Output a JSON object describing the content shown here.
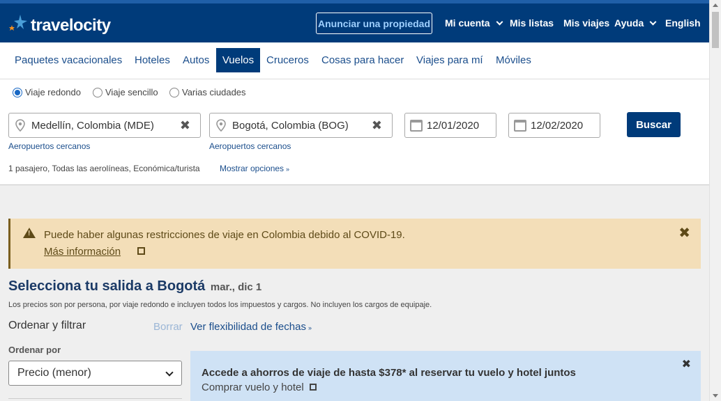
{
  "header": {
    "logo_text": "travelocity",
    "advertise_label": "Anunciar una propiedad",
    "nav": [
      "Mi cuenta",
      "Mis listas",
      "Mis viajes",
      "Ayuda",
      "English"
    ]
  },
  "tabs": [
    "Paquetes vacacionales",
    "Hoteles",
    "Autos",
    "Vuelos",
    "Cruceros",
    "Cosas para hacer",
    "Viajes para mí",
    "Móviles"
  ],
  "active_tab": "Vuelos",
  "search": {
    "trip_types": [
      "Viaje redondo",
      "Viaje sencillo",
      "Varias ciudades"
    ],
    "selected_trip_type": "Viaje redondo",
    "origin": "Medellín, Colombia (MDE)",
    "destination": "Bogotá, Colombia (BOG)",
    "depart_date": "12/01/2020",
    "return_date": "12/02/2020",
    "nearby_label": "Aeropuertos cercanos",
    "search_button": "Buscar",
    "passengers_summary": "1 pasajero, Todas las aerolíneas, Económica/turista",
    "show_options": "Mostrar opciones"
  },
  "alert": {
    "text": "Puede haber algunas restricciones de viaje en Colombia debido al COVID-19.",
    "link": "Más información"
  },
  "results": {
    "heading": "Selecciona tu salida a Bogotá",
    "heading_date": "mar., dic 1",
    "price_note": "Los precios son por persona, por viaje redondo e incluyen todos los impuestos y cargos. No incluyen los cargos de equipaje.",
    "sort_filter_title": "Ordenar y filtrar",
    "clear_label": "Borrar",
    "flex_dates": "Ver flexibilidad de fechas",
    "sort_by_label": "Ordenar por",
    "sort_value": "Precio (menor)"
  },
  "promo": {
    "title": "Accede a ahorros de viaje de hasta $378* al reservar tu vuelo y hotel juntos",
    "link": "Comprar vuelo y hotel"
  },
  "colors": {
    "header_bg": "#003b7a",
    "alert_bg": "#f3deb8",
    "promo_bg": "#cfe2f5",
    "link": "#1b4e8c"
  }
}
